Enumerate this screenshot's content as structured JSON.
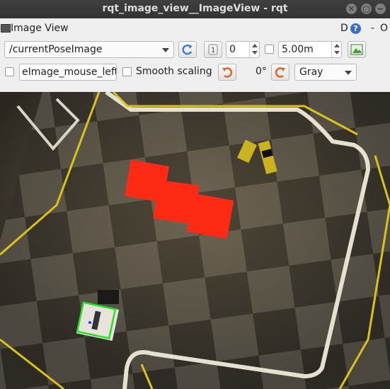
{
  "window": {
    "title": "rqt_image_view__ImageView - rqt"
  },
  "dock": {
    "title": "Image View",
    "d_label": "D",
    "help_icon": "?",
    "close_label": "O",
    "minus_label": "-"
  },
  "toolbar": {
    "topic": "/currentPoseImage",
    "rotation_spin_value": "0",
    "max_range_value": "5.00m",
    "mouse_topic_field": "eImage_mouse_left",
    "smooth_scaling_label": "Smooth scaling",
    "rotation_label": "0°",
    "color_scheme": "Gray"
  },
  "colors": {
    "titlebar_bg": "#383838",
    "panel_bg": "#efefef",
    "refresh_icon": "#3f7fd6",
    "rotate_icon": "#e0632a",
    "robot_marker": "#1ee61e"
  }
}
